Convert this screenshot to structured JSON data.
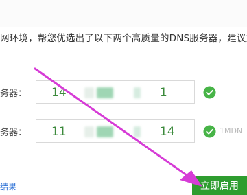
{
  "intro_text": "网环境，帮您优选出了以下两个高质量的DNS服务器，建议立",
  "dns_rows": [
    {
      "label": "务器：",
      "value_start": "14",
      "value_end": "1",
      "status_text": ""
    },
    {
      "label": "务器：",
      "value_start": "11",
      "value_end": "14",
      "status_text": "1MDN"
    }
  ],
  "result_link": "结果",
  "enable_button_label": "立即启用",
  "colors": {
    "accent_green": "#2e9d2f",
    "value_green": "#3c8a3c",
    "check_green": "#47b447",
    "arrow_magenta": "#d63bd6",
    "link_blue": "#2a6fd6"
  }
}
